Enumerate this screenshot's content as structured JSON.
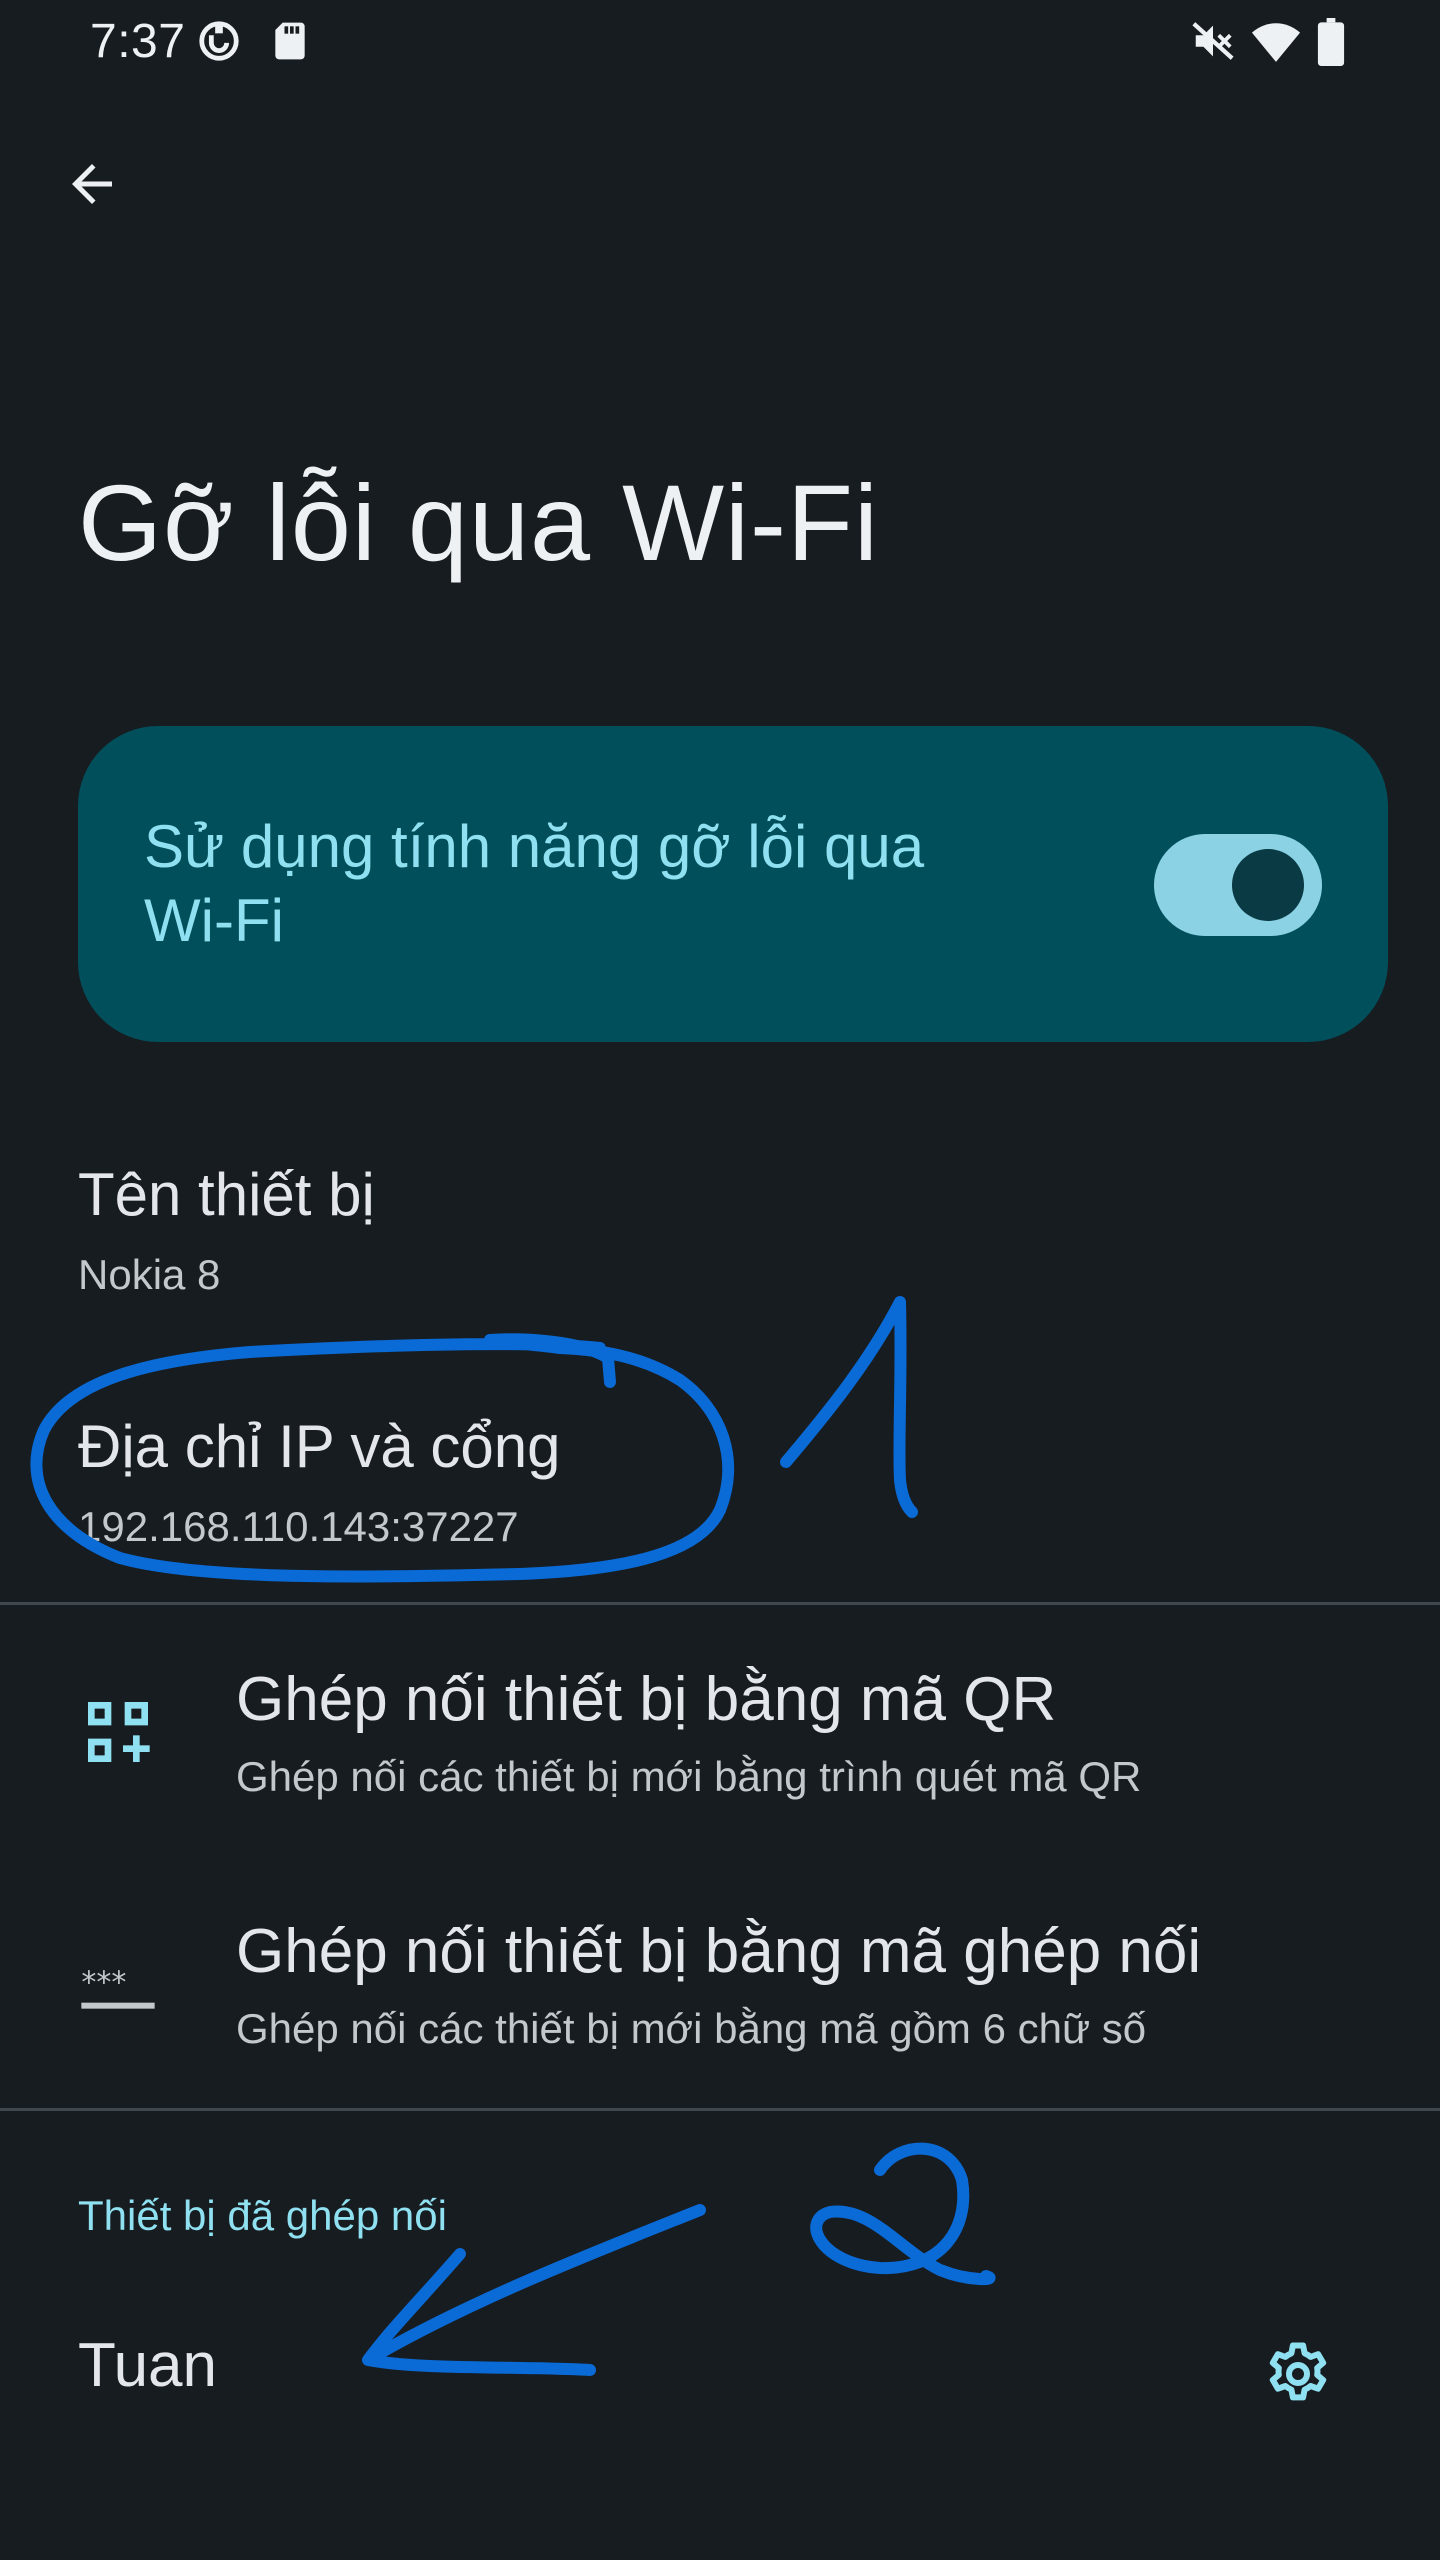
{
  "status_bar": {
    "time": "7:37",
    "icons": [
      "screenshot-icon",
      "sd-card-icon",
      "vibrate-off-icon",
      "wifi-icon",
      "battery-icon"
    ]
  },
  "app_bar": {
    "back_icon": "arrow-back-icon"
  },
  "page": {
    "title": "Gỡ lỗi qua Wi-Fi"
  },
  "main_switch": {
    "label": "Sử dụng tính năng gỡ lỗi qua Wi-Fi",
    "checked": true,
    "colors": {
      "card": "#004f5b",
      "track": "#8ad2e4",
      "thumb": "#0a3a44"
    }
  },
  "device_name": {
    "title": "Tên thiết bị",
    "summary": "Nokia 8"
  },
  "ip_port": {
    "title": "Địa chỉ IP và cổng",
    "summary": "192.168.110.143:37227"
  },
  "pair_qr": {
    "icon": "qr-code-add-icon",
    "title": "Ghép nối thiết bị bằng mã QR",
    "summary": "Ghép nối các thiết bị mới bằng trình quét mã QR"
  },
  "pair_code": {
    "icon": "password-icon",
    "title": "Ghép nối thiết bị bằng mã ghép nối",
    "summary": "Ghép nối các thiết bị mới bằng mã gồm 6 chữ số"
  },
  "paired_devices": {
    "header": "Thiết bị đã ghép nối",
    "items": [
      {
        "name": "Tuan",
        "settings_icon": "gear-icon"
      }
    ]
  },
  "annotations": {
    "color": "#0a6ad6",
    "marks": [
      "1",
      "2"
    ]
  },
  "theme": {
    "background": "#171c20",
    "accent": "#8fe0f0",
    "divider": "#41484d"
  }
}
